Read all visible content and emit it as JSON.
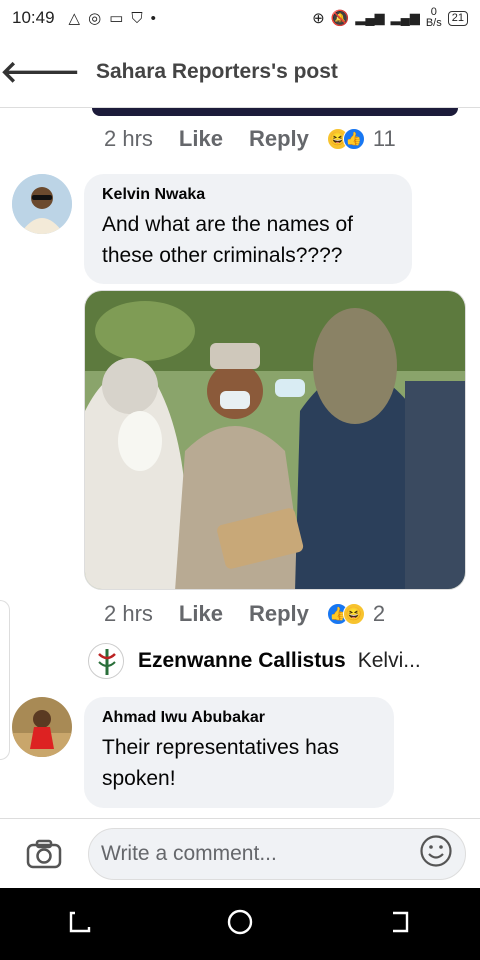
{
  "status_bar": {
    "time": "10:49",
    "net_speed_value": "0",
    "net_speed_unit": "B/s",
    "battery": "21"
  },
  "header": {
    "title": "Sahara Reporters's post"
  },
  "comment0_actions": {
    "time": "2 hrs",
    "like": "Like",
    "reply": "Reply",
    "count": "11"
  },
  "comment1": {
    "author": "Kelvin Nwaka",
    "text": "And what are the names of these other criminals????",
    "time": "2 hrs",
    "like": "Like",
    "reply": "Reply",
    "reaction_count": "2"
  },
  "reply_preview": {
    "author": "Ezenwanne Callistus",
    "snippet": "Kelvi..."
  },
  "comment2": {
    "author": "Ahmad Iwu Abubakar",
    "text": "Their representatives has spoken!"
  },
  "composer": {
    "placeholder": "Write a comment..."
  },
  "colors": {
    "accent": "#1877f2",
    "bubble": "#f0f2f5",
    "muted": "#65676b"
  }
}
